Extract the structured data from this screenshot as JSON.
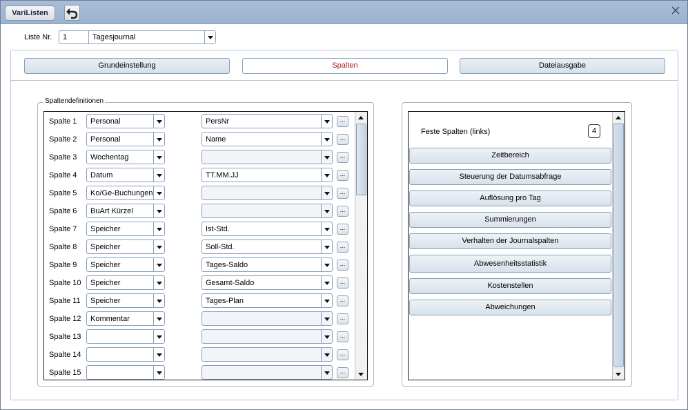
{
  "app": {
    "title_button": "VariListen"
  },
  "liste": {
    "label": "Liste Nr.",
    "number": "1",
    "name": "Tagesjournal"
  },
  "tabs": [
    {
      "label": "Grundeinstellung",
      "active": false
    },
    {
      "label": "Spalten",
      "active": true
    },
    {
      "label": "Dateiausgabe",
      "active": false
    }
  ],
  "spalten": {
    "group_title": "Spaltendefinitionen",
    "rows": [
      {
        "label": "Spalte 1",
        "field": "Personal",
        "format": "PersNr"
      },
      {
        "label": "Spalte 2",
        "field": "Personal",
        "format": "Name"
      },
      {
        "label": "Spalte 3",
        "field": "Wochentag",
        "format": ""
      },
      {
        "label": "Spalte 4",
        "field": "Datum",
        "format": "TT.MM.JJ"
      },
      {
        "label": "Spalte 5",
        "field": "Ko/Ge-Buchungen",
        "format": ""
      },
      {
        "label": "Spalte 6",
        "field": "BuArt Kürzel",
        "format": ""
      },
      {
        "label": "Spalte 7",
        "field": "Speicher",
        "format": "Ist-Std."
      },
      {
        "label": "Spalte 8",
        "field": "Speicher",
        "format": "Soll-Std."
      },
      {
        "label": "Spalte 9",
        "field": "Speicher",
        "format": "Tages-Saldo"
      },
      {
        "label": "Spalte 10",
        "field": "Speicher",
        "format": "Gesamt-Saldo"
      },
      {
        "label": "Spalte 11",
        "field": "Speicher",
        "format": "Tages-Plan"
      },
      {
        "label": "Spalte 12",
        "field": "Kommentar",
        "format": ""
      },
      {
        "label": "Spalte 13",
        "field": "",
        "format": ""
      },
      {
        "label": "Spalte 14",
        "field": "",
        "format": ""
      },
      {
        "label": "Spalte 15",
        "field": "",
        "format": ""
      }
    ],
    "dots_label": "..."
  },
  "right": {
    "feste_label": "Feste Spalten (links)",
    "feste_value": "4",
    "buttons": [
      "Zeitbereich",
      "Steuerung der Datumsabfrage",
      "Auflösung pro Tag",
      "Summierungen",
      "Verhalten der Journalspalten",
      "Abwesenheitsstatistik",
      "Kostenstellen",
      "Abweichungen"
    ]
  },
  "icons": {
    "undo": "undo-arrow-icon",
    "close": "close-icon"
  },
  "colors": {
    "titlebar": "#a9bdd6",
    "active_tab_text": "#b01818"
  }
}
